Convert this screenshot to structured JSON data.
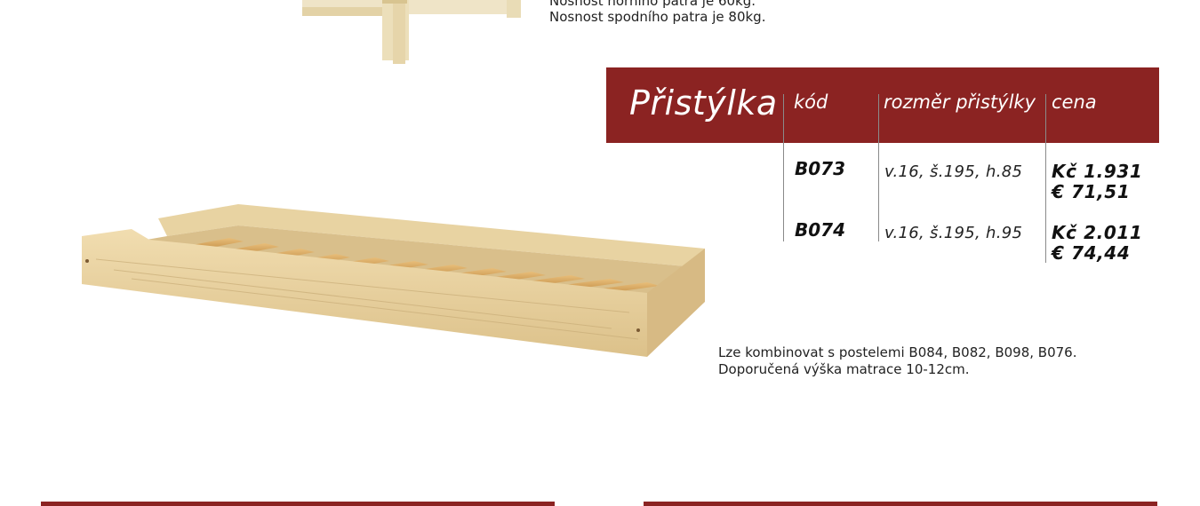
{
  "top_notes": [
    "Nosnost horního patra je 60kg.",
    "Nosnost spodního patra je 80kg."
  ],
  "table": {
    "title": "Přistýlka",
    "headers": {
      "code": "kód",
      "dimension": "rozměr přistýlky",
      "price": "cena"
    },
    "rows": [
      {
        "code": "B073",
        "dimension": "v.16, š.195, h.85",
        "price_czk": "Kč 1.931",
        "price_eur": "€ 71,51"
      },
      {
        "code": "B074",
        "dimension": "v.16, š.195, h.95",
        "price_czk": "Kč 2.011",
        "price_eur": "€ 74,44"
      }
    ]
  },
  "notes": [
    "Lze kombinovat s postelemi B084, B082, B098, B076.",
    "Doporučená výška matrace 10-12cm."
  ],
  "colors": {
    "accent": "#8b2322",
    "wood": "#e6cf9c"
  }
}
